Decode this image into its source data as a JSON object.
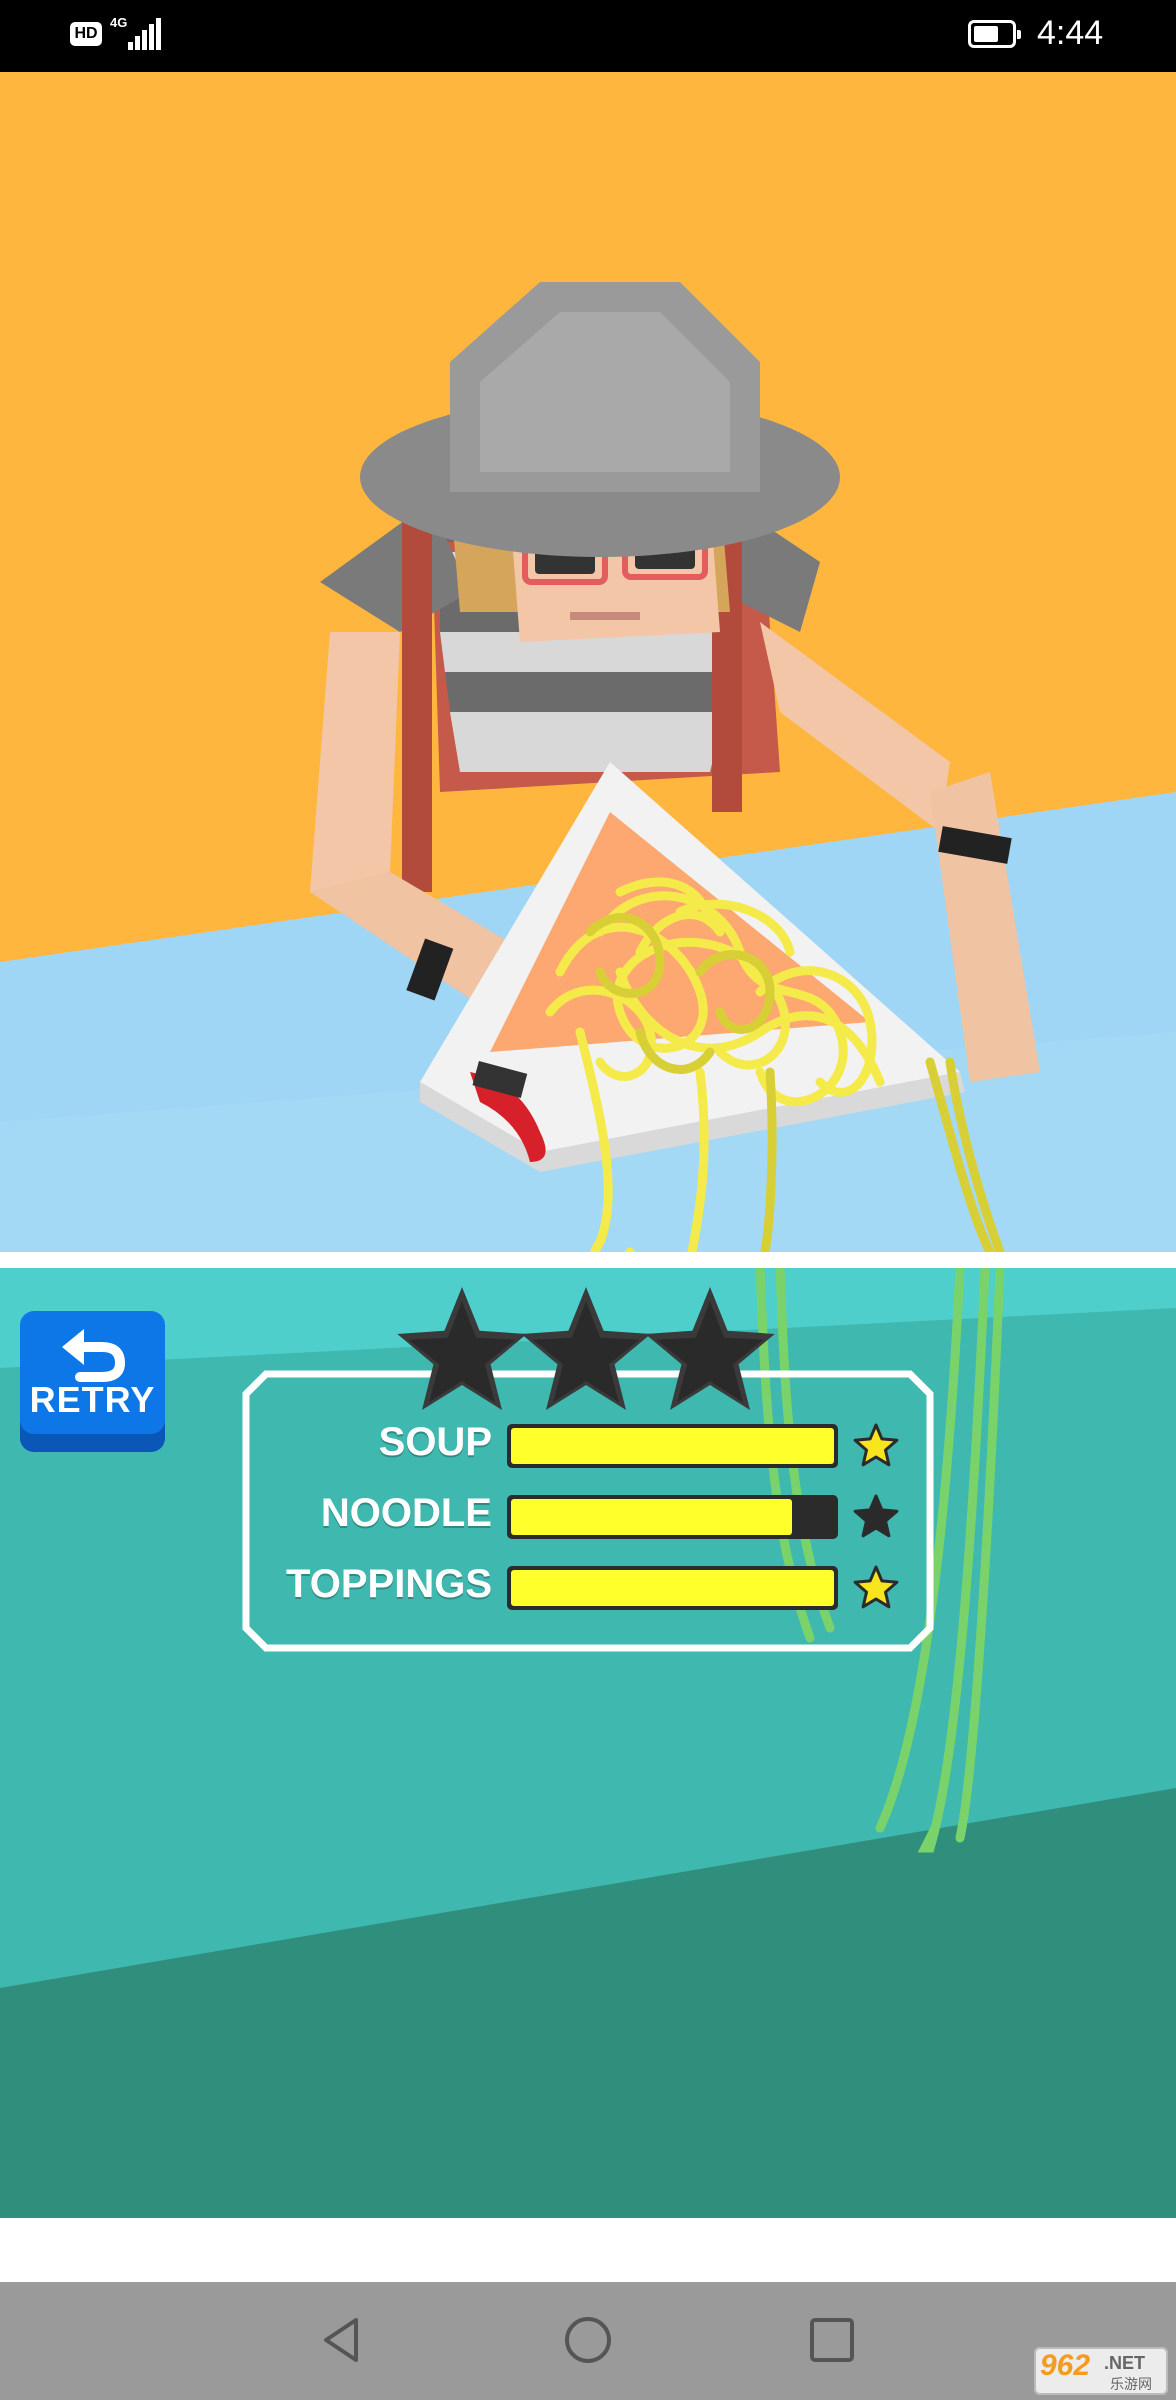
{
  "status_bar": {
    "hd_label": "HD",
    "network_label": "4G",
    "time": "4:44"
  },
  "retry_button": {
    "label": "RETRY"
  },
  "score_panel": {
    "earned_stars": 0,
    "total_stars": 3,
    "rows": [
      {
        "label": "SOUP",
        "progress": 1.0,
        "star_earned": true
      },
      {
        "label": "NOODLE",
        "progress": 0.87,
        "star_earned": false
      },
      {
        "label": "TOPPINGS",
        "progress": 1.0,
        "star_earned": true
      }
    ]
  },
  "colors": {
    "sky": "#ffb63f",
    "table": "#9fd6f5",
    "lower_bg": "#3fb8b0",
    "lower_floor": "#2f8f7c",
    "bar_fill": "#ffff2b",
    "star_gold": "#f8e51e",
    "star_dark": "#2a2a2a",
    "retry_blue": "#0e77e8"
  },
  "watermark": {
    "brand": "962",
    "suffix": ".NET",
    "sub": "乐游网"
  }
}
